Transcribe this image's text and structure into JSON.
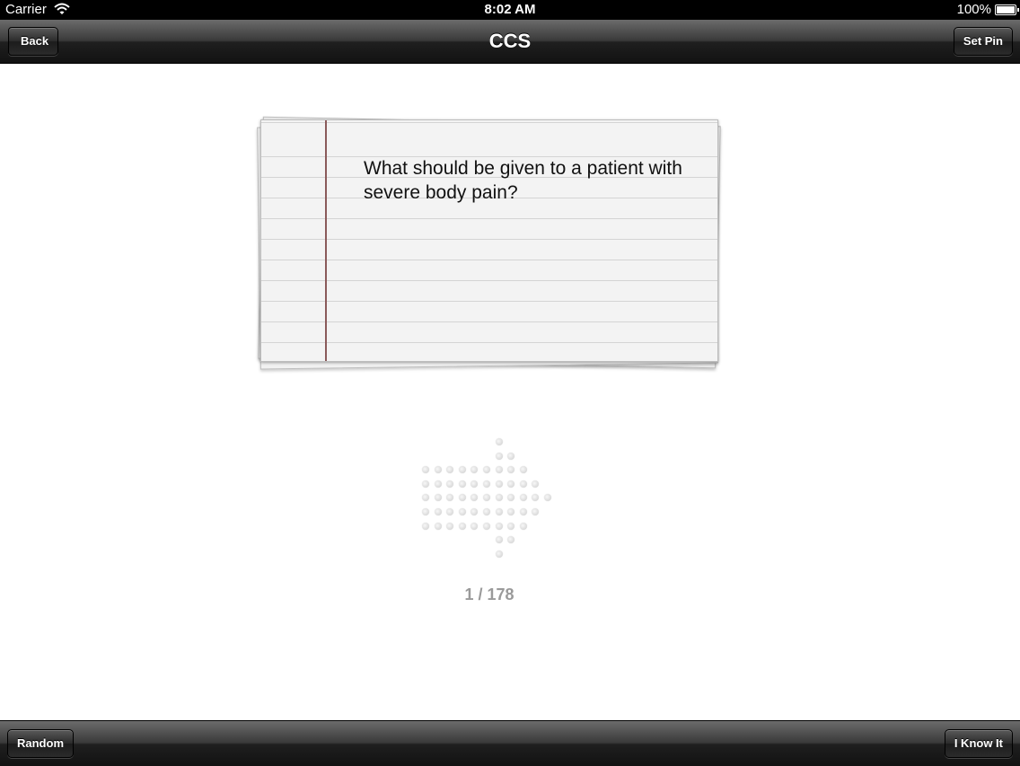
{
  "status_bar": {
    "carrier": "Carrier",
    "time": "8:02 AM",
    "battery": "100%"
  },
  "nav": {
    "title": "CCS",
    "back_label": "Back",
    "set_pin_label": "Set Pin"
  },
  "card": {
    "question": "What should be given to a patient with severe body pain?"
  },
  "counter": "1 / 178",
  "toolbar": {
    "random_label": "Random",
    "know_it_label": "I Know It"
  },
  "icons": {
    "next": "arrow-right-icon",
    "wifi": "wifi-icon",
    "battery": "battery-icon"
  }
}
